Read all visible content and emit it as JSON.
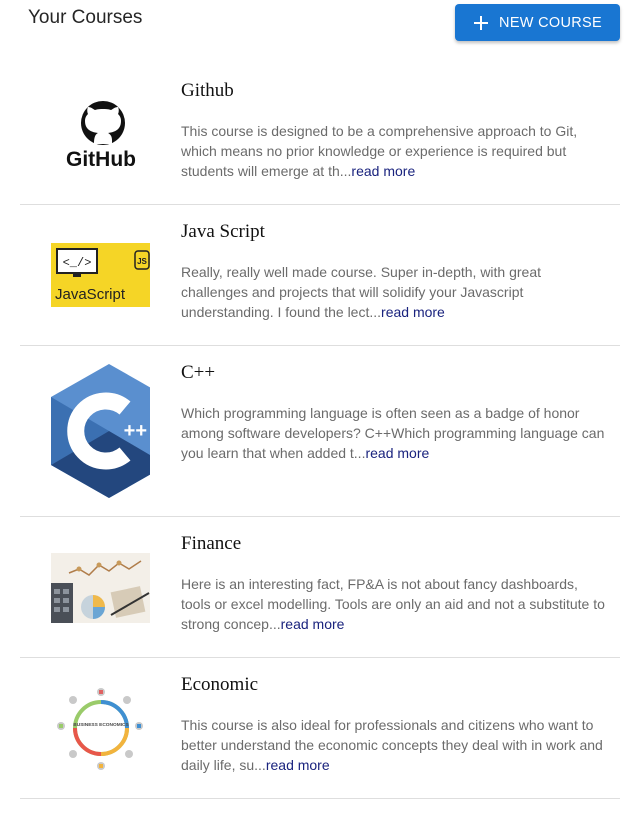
{
  "header": {
    "title": "Your Courses",
    "new_course_label": "NEW COURSE",
    "button_color": "#1976d2"
  },
  "courses": [
    {
      "title": "Github",
      "description": "This course is designed to be a comprehensive approach to Git, which means no prior knowledge or experience is required but students will emerge at th...",
      "read_more": "read more",
      "thumbnail": "github-logo",
      "thumbnail_text": "GitHub"
    },
    {
      "title": "Java Script",
      "description": "Really, really well made course. Super in-depth, with great challenges and projects that will solidify your Javascript understanding. I found the lect...",
      "read_more": "read more",
      "thumbnail": "javascript-thumbnail",
      "thumbnail_text": "JavaScript"
    },
    {
      "title": "C++",
      "description": "Which programming language is often seen as a badge of honor among software developers? C++Which programming language can you learn that when added t...",
      "read_more": "read more",
      "thumbnail": "cpp-logo",
      "thumbnail_text": "++"
    },
    {
      "title": "Finance",
      "description": "Here is an interesting fact, FP&A is not about fancy dashboards, tools or excel modelling. Tools are only an aid and not a substitute to strong concep...",
      "read_more": "read more",
      "thumbnail": "finance-photo"
    },
    {
      "title": "Economic",
      "description": "This course is also ideal for professionals and citizens who want to better understand the economic concepts they deal with in work and daily life, su...",
      "read_more": "read more",
      "thumbnail": "economics-diagram",
      "thumbnail_text": "BUSINESS ECONOMICS"
    }
  ]
}
